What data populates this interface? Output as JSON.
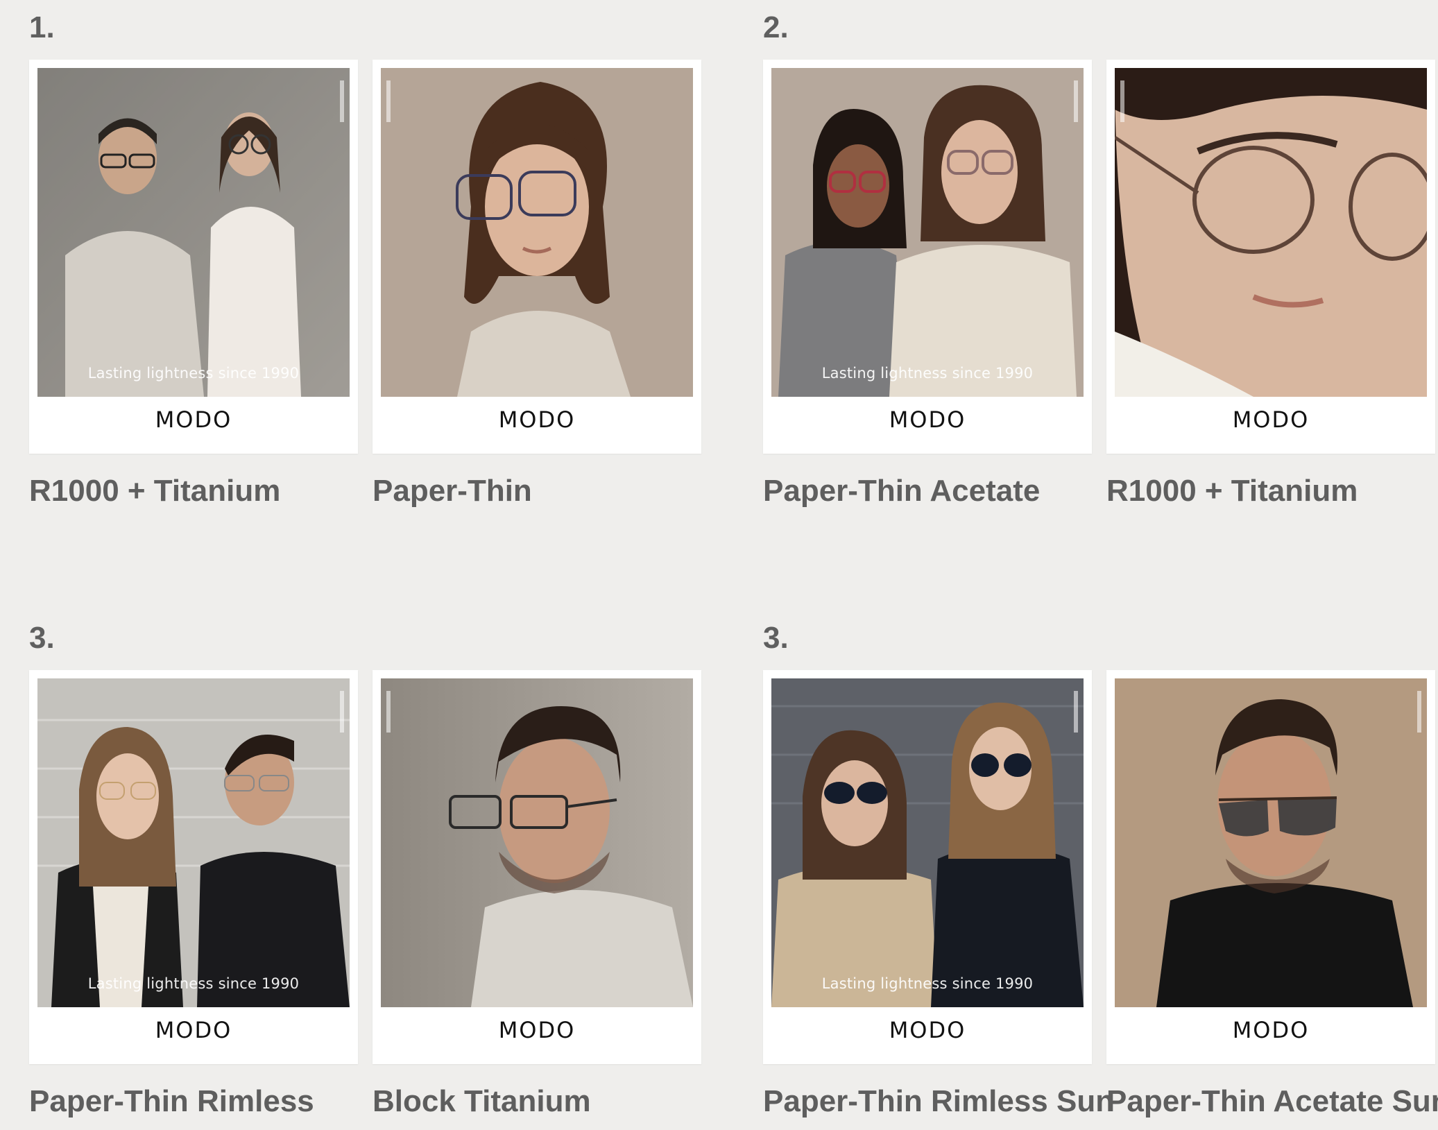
{
  "groups": [
    {
      "number": "1.",
      "items": [
        {
          "brand": "MODO",
          "tagline": "Lasting lightness since 1990",
          "label": "R1000 + Titanium",
          "photo": "couple-glasses-photo",
          "bg": "#8c8a86"
        },
        {
          "brand": "MODO",
          "tagline": "",
          "label": "Paper-Thin",
          "photo": "woman-glasses-portrait",
          "bg": "#b5a597"
        }
      ]
    },
    {
      "number": "2.",
      "items": [
        {
          "brand": "MODO",
          "tagline": "Lasting lightness since 1990",
          "label": "Paper-Thin Acetate",
          "photo": "two-women-glasses-photo",
          "bg": "#b6a89c"
        },
        {
          "brand": "MODO",
          "tagline": "",
          "label": "R1000 + Titanium",
          "photo": "woman-closeup-glasses-photo",
          "bg": "#d8c2b0"
        }
      ]
    },
    {
      "number": "3.",
      "items": [
        {
          "brand": "MODO",
          "tagline": "Lasting lightness since 1990",
          "label": "Paper-Thin Rimless",
          "photo": "couple-rimless-photo",
          "bg": "#bdbbb6"
        },
        {
          "brand": "MODO",
          "tagline": "",
          "label": "Block Titanium",
          "photo": "man-glasses-portrait",
          "bg": "#a09a92"
        }
      ]
    },
    {
      "number": "3.",
      "items": [
        {
          "brand": "MODO",
          "tagline": "Lasting lightness since 1990",
          "label": "Paper-Thin Rimless Sun",
          "photo": "two-women-sunglasses-photo",
          "bg": "#5e6168"
        },
        {
          "brand": "MODO",
          "tagline": "",
          "label": "Paper-Thin Acetate Sun",
          "photo": "man-sunglasses-portrait",
          "bg": "#b49a80"
        }
      ]
    }
  ],
  "colors": {
    "page_bg": "#efeeec",
    "label_text": "#5e5e5e",
    "brand_text": "#111111",
    "card_bg": "#ffffff"
  }
}
